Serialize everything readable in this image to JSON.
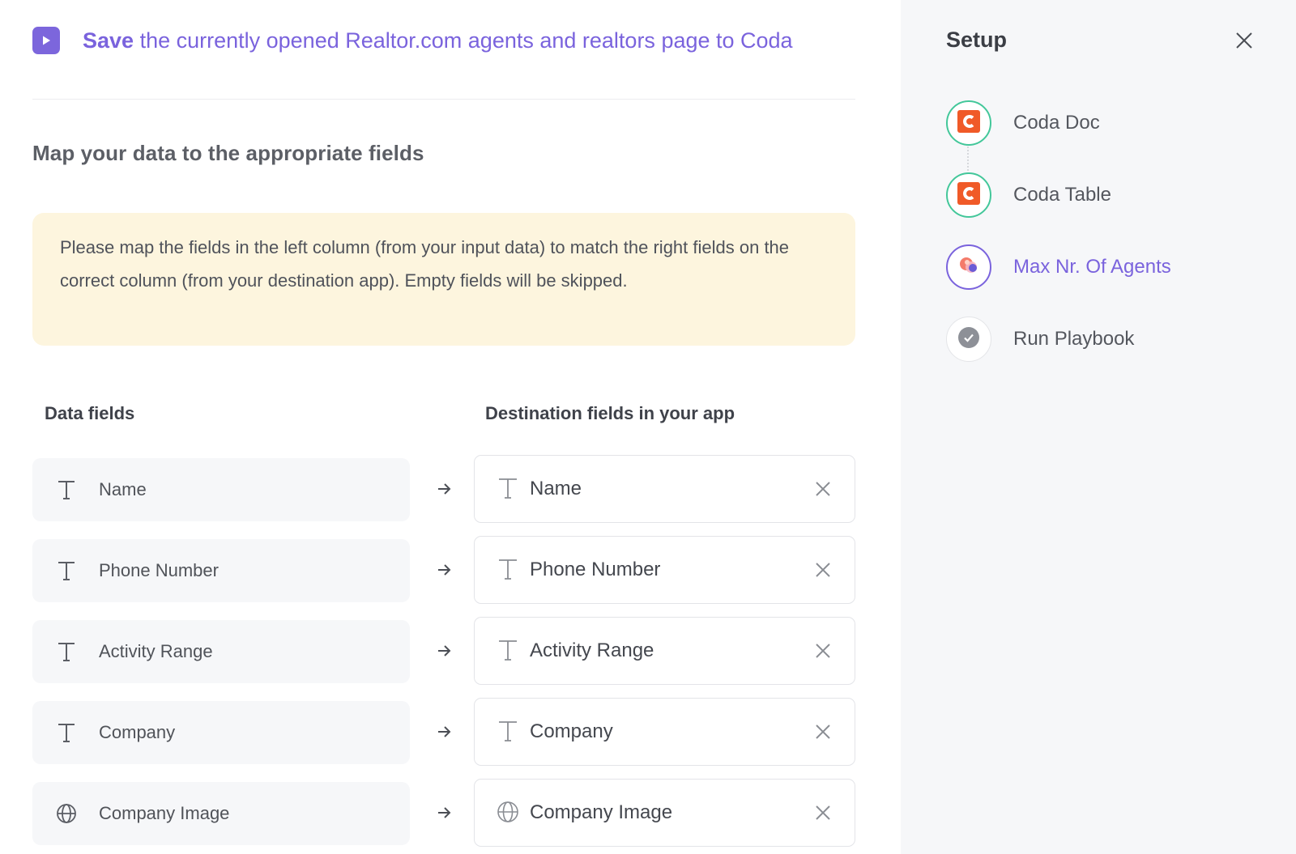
{
  "header": {
    "title_strong": "Save",
    "title_rest": " the currently opened Realtor.com agents and realtors page to Coda",
    "icon": "play-icon"
  },
  "mapping": {
    "section_title": "Map your data to the appropriate fields",
    "notice": "Please map the fields in the left column (from your input data) to match the right fields on the correct column (from your destination app). Empty fields will be skipped.",
    "left_header": "Data fields",
    "right_header": "Destination fields in your app",
    "rows": [
      {
        "source": "Name",
        "destination": "Name",
        "type_icon": "text-type-icon"
      },
      {
        "source": "Phone Number",
        "destination": "Phone Number",
        "type_icon": "text-type-icon"
      },
      {
        "source": "Activity Range",
        "destination": "Activity Range",
        "type_icon": "text-type-icon"
      },
      {
        "source": "Company",
        "destination": "Company",
        "type_icon": "text-type-icon"
      },
      {
        "source": "Company Image",
        "destination": "Company Image",
        "type_icon": "globe-icon"
      }
    ]
  },
  "setup": {
    "title": "Setup",
    "steps": [
      {
        "label": "Coda Doc",
        "state": "done",
        "icon": "coda-logo-icon"
      },
      {
        "label": "Coda Table",
        "state": "done",
        "icon": "coda-logo-icon"
      },
      {
        "label": "Max Nr. Of Agents",
        "state": "active",
        "icon": "bardeen-app-icon"
      },
      {
        "label": "Run Playbook",
        "state": "pending",
        "icon": "check-circle-icon"
      }
    ]
  },
  "colors": {
    "accent": "#7a63dd",
    "success": "#43c79a",
    "coda": "#f05a28",
    "notice_bg": "#fdf5de",
    "sidebar_bg": "#f6f7f9"
  }
}
